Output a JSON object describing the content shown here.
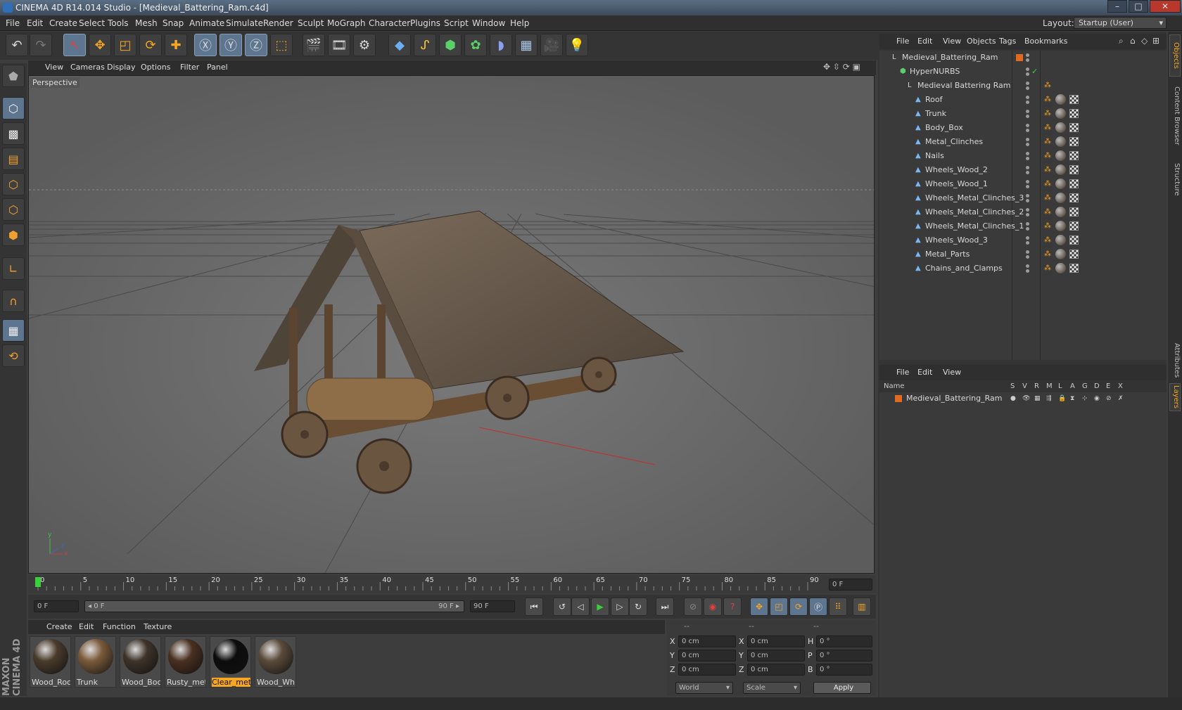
{
  "window": {
    "title": "CINEMA 4D R14.014 Studio - [Medieval_Battering_Ram.c4d]",
    "min": "–",
    "max": "□",
    "close": "✕"
  },
  "menubar": {
    "items": [
      "File",
      "Edit",
      "Create",
      "Select",
      "Tools",
      "Mesh",
      "Snap",
      "Animate",
      "Simulate",
      "Render",
      "Sculpt",
      "MoGraph",
      "Character",
      "Plugins",
      "Script",
      "Window",
      "Help"
    ],
    "layout_label": "Layout:",
    "layout_value": "Startup (User)"
  },
  "viewport": {
    "menu": [
      "View",
      "Cameras",
      "Display",
      "Options",
      "Filter",
      "Panel"
    ],
    "label": "Perspective",
    "axis_y": "y",
    "axis_z": "z",
    "axis_x": "x"
  },
  "timeline": {
    "ticks": [
      "0",
      "5",
      "10",
      "15",
      "20",
      "25",
      "30",
      "35",
      "40",
      "45",
      "50",
      "55",
      "60",
      "65",
      "70",
      "75",
      "80",
      "85",
      "90"
    ],
    "current_frame": "0 F"
  },
  "transport": {
    "start_field": "0 F",
    "range_start": "◂ 0 F",
    "range_end": "90 F ▸",
    "end_field": "90 F"
  },
  "materials": {
    "menu": [
      "Create",
      "Edit",
      "Function",
      "Texture"
    ],
    "items": [
      {
        "name": "Wood_Roc",
        "color": "#4a3b2c"
      },
      {
        "name": "Trunk",
        "color": "#7a5a3a"
      },
      {
        "name": "Wood_Boc",
        "color": "#3e332a"
      },
      {
        "name": "Rusty_meta",
        "color": "#4a3020"
      },
      {
        "name": "Clear_meta",
        "color": "#0c0c0c"
      },
      {
        "name": "Wood_Wh",
        "color": "#5a4a3a"
      }
    ],
    "brand": "MAXON CINEMA 4D"
  },
  "coords": {
    "head": [
      "--",
      "--",
      "--"
    ],
    "rows": [
      {
        "a": "X",
        "av": "0 cm",
        "b": "X",
        "bv": "0 cm",
        "c": "H",
        "cv": "0 °"
      },
      {
        "a": "Y",
        "av": "0 cm",
        "b": "Y",
        "bv": "0 cm",
        "c": "P",
        "cv": "0 °"
      },
      {
        "a": "Z",
        "av": "0 cm",
        "b": "Z",
        "bv": "0 cm",
        "c": "B",
        "cv": "0 °"
      }
    ],
    "mode1": "World",
    "mode2": "Scale",
    "apply": "Apply"
  },
  "objects": {
    "menu": [
      "File",
      "Edit",
      "View",
      "Objects",
      "Tags",
      "Bookmarks"
    ],
    "rows": [
      {
        "name": "Medieval_Battering_Ram",
        "indent": 0,
        "kind": "null"
      },
      {
        "name": "HyperNURBS",
        "indent": 1,
        "kind": "nurbs"
      },
      {
        "name": "Medieval Battering Ram",
        "indent": 2,
        "kind": "null"
      },
      {
        "name": "Roof",
        "indent": 3,
        "kind": "poly"
      },
      {
        "name": "Trunk",
        "indent": 3,
        "kind": "poly"
      },
      {
        "name": "Body_Box",
        "indent": 3,
        "kind": "poly"
      },
      {
        "name": "Metal_Clinches",
        "indent": 3,
        "kind": "poly"
      },
      {
        "name": "Nails",
        "indent": 3,
        "kind": "poly"
      },
      {
        "name": "Wheels_Wood_2",
        "indent": 3,
        "kind": "poly"
      },
      {
        "name": "Wheels_Wood_1",
        "indent": 3,
        "kind": "poly"
      },
      {
        "name": "Wheels_Metal_Clinches_3",
        "indent": 3,
        "kind": "poly"
      },
      {
        "name": "Wheels_Metal_Clinches_2",
        "indent": 3,
        "kind": "poly"
      },
      {
        "name": "Wheels_Metal_Clinches_1",
        "indent": 3,
        "kind": "poly"
      },
      {
        "name": "Wheels_Wood_3",
        "indent": 3,
        "kind": "poly"
      },
      {
        "name": "Metal_Parts",
        "indent": 3,
        "kind": "poly"
      },
      {
        "name": "Chains_and_Clamps",
        "indent": 3,
        "kind": "poly"
      }
    ]
  },
  "layers": {
    "menu": [
      "File",
      "Edit",
      "View"
    ],
    "head": {
      "name": "Name",
      "cols": [
        "S",
        "V",
        "R",
        "M",
        "L",
        "A",
        "G",
        "D",
        "E",
        "X"
      ]
    },
    "rows": [
      {
        "name": "Medieval_Battering_Ram",
        "color": "#e06a20"
      }
    ]
  },
  "sidetabs": [
    "Objects",
    "Content Browser",
    "Structure",
    "Attributes",
    "Layers"
  ]
}
